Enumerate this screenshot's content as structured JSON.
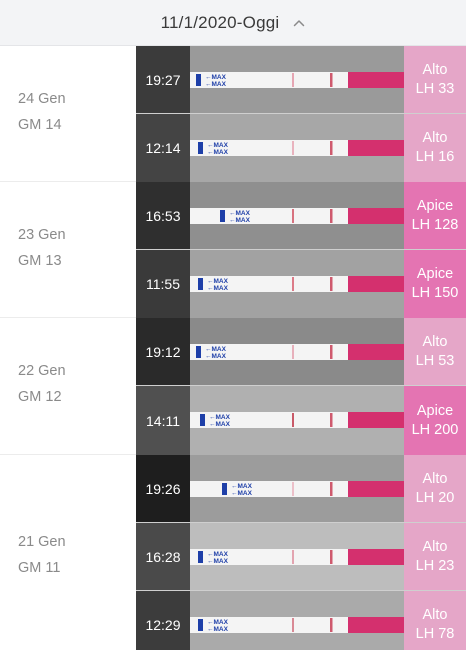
{
  "header": {
    "date_range": "11/1/2020-Oggi",
    "toggle_icon": "chevron-up-icon"
  },
  "colors": {
    "alto": "#e5a6c8",
    "apice": "#e474b2",
    "strip_pink": "#d4306e",
    "strip_blue": "#1e3fa8"
  },
  "strip_text": "MAX",
  "days": [
    {
      "date": "24 Gen",
      "cycle_day": "GM 14",
      "entries": [
        {
          "time": "19:27",
          "level": "Alto",
          "lh": "LH 33",
          "kind": "alto"
        },
        {
          "time": "12:14",
          "level": "Alto",
          "lh": "LH 16",
          "kind": "alto"
        }
      ]
    },
    {
      "date": "23 Gen",
      "cycle_day": "GM 13",
      "entries": [
        {
          "time": "16:53",
          "level": "Apice",
          "lh": "LH 128",
          "kind": "apice"
        },
        {
          "time": "11:55",
          "level": "Apice",
          "lh": "LH 150",
          "kind": "apice"
        }
      ]
    },
    {
      "date": "22 Gen",
      "cycle_day": "GM 12",
      "entries": [
        {
          "time": "19:12",
          "level": "Alto",
          "lh": "LH 53",
          "kind": "alto"
        },
        {
          "time": "14:11",
          "level": "Apice",
          "lh": "LH 200",
          "kind": "apice"
        }
      ]
    },
    {
      "date": "21 Gen",
      "cycle_day": "GM 11",
      "entries": [
        {
          "time": "19:26",
          "level": "Alto",
          "lh": "LH 20",
          "kind": "alto"
        },
        {
          "time": "16:28",
          "level": "Alto",
          "lh": "LH 23",
          "kind": "alto"
        },
        {
          "time": "12:29",
          "level": "Alto",
          "lh": "LH 78",
          "kind": "alto"
        }
      ]
    }
  ]
}
